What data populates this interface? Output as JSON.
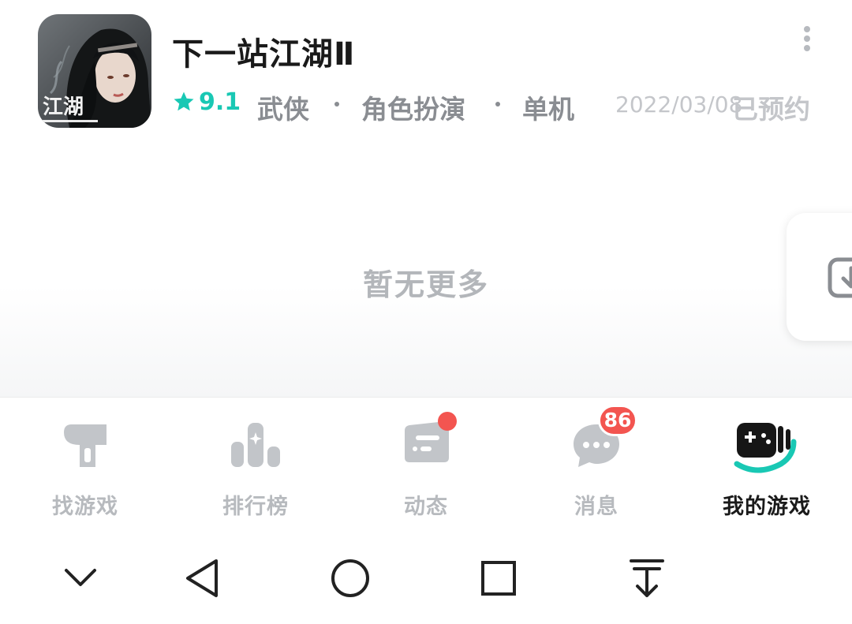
{
  "game": {
    "title": "下一站江湖Ⅱ",
    "icon": "game-cover-art",
    "icon_caption": "江湖",
    "rating": "9.1",
    "tags": [
      "武侠",
      "角色扮演",
      "单机"
    ],
    "release_date": "2022/03/08",
    "status": "已预约"
  },
  "content": {
    "empty_text": "暂无更多"
  },
  "bottom_nav": {
    "items": [
      {
        "label": "找游戏",
        "icon": "find-games-icon"
      },
      {
        "label": "排行榜",
        "icon": "leaderboard-icon"
      },
      {
        "label": "动态",
        "icon": "feed-icon"
      },
      {
        "label": "消息",
        "icon": "messages-icon",
        "badge": "86"
      },
      {
        "label": "我的游戏",
        "icon": "my-games-icon"
      }
    ],
    "active_index": 4
  },
  "system_nav": {
    "buttons": [
      "collapse-icon",
      "back-icon",
      "home-icon",
      "recents-icon",
      "download-drawer-icon"
    ]
  },
  "colors": {
    "accent": "#19c8b4",
    "badge": "#f35550",
    "muted": "#b7babe",
    "text": "#1a1a1a"
  }
}
